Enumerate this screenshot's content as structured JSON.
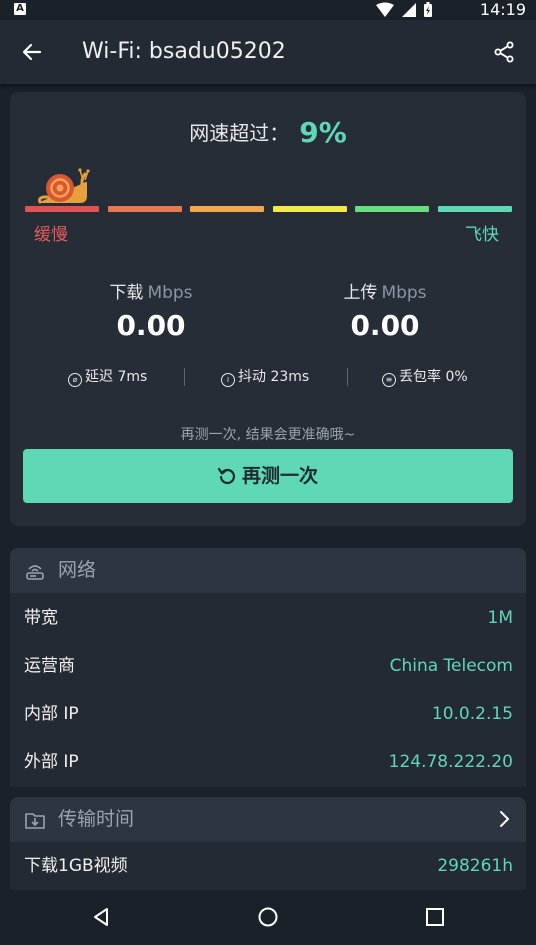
{
  "status_bar": {
    "time": "14:19",
    "a_icon_letter": "A"
  },
  "app_bar": {
    "title": "Wi-Fi: bsadu05202"
  },
  "result": {
    "score_label": "网速超过：",
    "score_value": "9%",
    "scale_slow": "缓慢",
    "scale_fast": "飞快",
    "scale_colors": [
      "#e05353",
      "#e8794f",
      "#f2a74d",
      "#f2e94a",
      "#66e07f",
      "#5fd8b6"
    ],
    "download": {
      "label": "下载",
      "unit": "Mbps",
      "value": "0.00"
    },
    "upload": {
      "label": "上传",
      "unit": "Mbps",
      "value": "0.00"
    },
    "latency": "延迟 7ms",
    "jitter": "抖动 23ms",
    "packet_loss": "丢包率 0%",
    "hint": "再测一次, 结果会更准确哦~",
    "retest_button": "再测一次"
  },
  "network_section": {
    "title": "网络",
    "rows": [
      {
        "key": "带宽",
        "value": "1M"
      },
      {
        "key": "运营商",
        "value": "China Telecom"
      },
      {
        "key": "内部 IP",
        "value": "10.0.2.15"
      },
      {
        "key": "外部 IP",
        "value": "124.78.222.20"
      }
    ]
  },
  "transfer_section": {
    "title": "传输时间",
    "rows": [
      {
        "key": "下载1GB视频",
        "value": "298261h"
      }
    ]
  },
  "colors": {
    "accent": "#5fd8b6",
    "slow": "#e55a5a",
    "background": "#1b2129",
    "card": "#262d37"
  }
}
